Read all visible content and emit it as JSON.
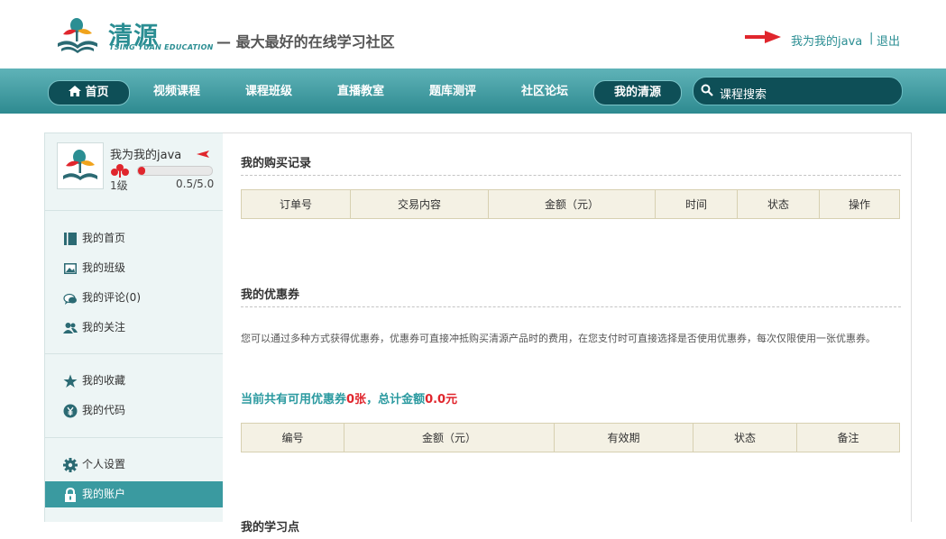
{
  "header": {
    "logo_title": "清源",
    "logo_sub": "TSING YUAN EDUCATION",
    "slogan": "— 最大最好的在线学习社区",
    "username": "我为我的java",
    "separator": "|",
    "logout": "退出"
  },
  "nav": {
    "items": [
      {
        "label": "首页",
        "active": true
      },
      {
        "label": "视频课程"
      },
      {
        "label": "课程班级"
      },
      {
        "label": "直播教室"
      },
      {
        "label": "题库测评"
      },
      {
        "label": "社区论坛"
      },
      {
        "label": "我的清源",
        "active": true
      }
    ],
    "search_placeholder": "课程搜索"
  },
  "profile": {
    "name": "我为我的java",
    "level": "1级",
    "score": "0.5/5.0",
    "progress": 0.1
  },
  "sidebar": {
    "group1": [
      {
        "label": "我的首页",
        "icon": "book-icon"
      },
      {
        "label": "我的班级",
        "icon": "image-icon"
      },
      {
        "label": "我的评论(0)",
        "icon": "comment-icon"
      },
      {
        "label": "我的关注",
        "icon": "users-icon"
      }
    ],
    "group2": [
      {
        "label": "我的收藏",
        "icon": "star-icon"
      },
      {
        "label": "我的代码",
        "icon": "yen-icon"
      }
    ],
    "group3": [
      {
        "label": "个人设置",
        "icon": "gear-icon"
      },
      {
        "label": "我的账户",
        "icon": "lock-icon",
        "active": true
      }
    ]
  },
  "purchases": {
    "title": "我的购买记录",
    "columns": [
      "订单号",
      "交易内容",
      "金额（元）",
      "时间",
      "状态",
      "操作"
    ]
  },
  "coupons": {
    "title": "我的优惠券",
    "description": "您可以通过多种方式获得优惠券，优惠券可直接冲抵购买清源产品时的费用，在您支付时可直接选择是否使用优惠券，每次仅限使用一张优惠券。",
    "summary_prefix": "当前共有可用优惠券",
    "count": "0张",
    "summary_mid": "，总计金额",
    "amount": "0.0元",
    "columns": [
      "编号",
      "金额（元）",
      "有效期",
      "状态",
      "备注"
    ]
  },
  "points": {
    "title": "我的学习点"
  },
  "colors": {
    "brand": "#2b8e93",
    "nav_dark": "#0e4f57",
    "accent_red": "#e0262d",
    "table_header": "#f4f1e4"
  }
}
